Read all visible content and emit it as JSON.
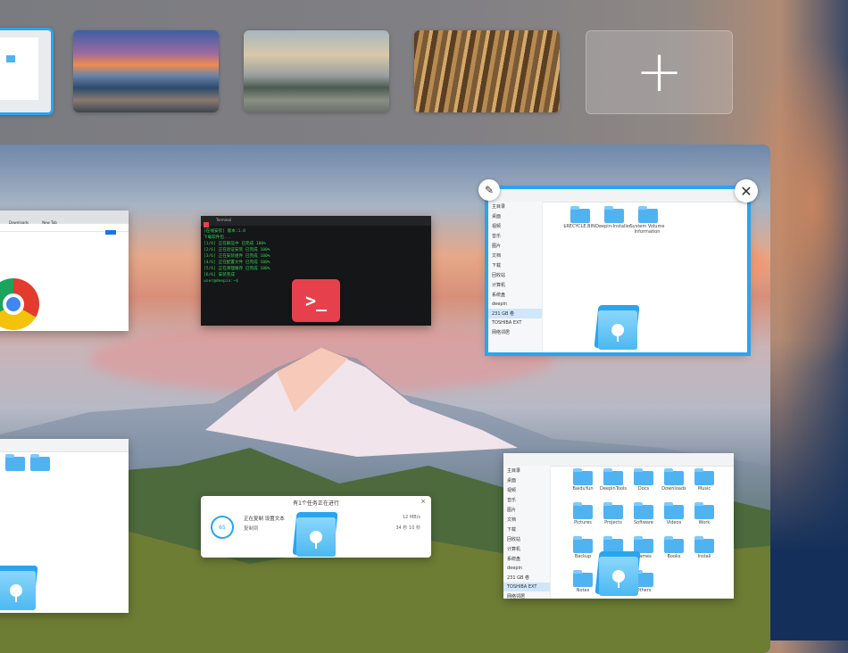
{
  "workspaces": {
    "add_label": "+",
    "items": [
      "workspace-1",
      "workspace-2",
      "workspace-3",
      "workspace-4"
    ]
  },
  "controls": {
    "close_label": "✕",
    "pin_label": "✎"
  },
  "terminal": {
    "tab_label": "Terminal",
    "prompt_glyph": ">_",
    "lines": [
      "[在线安装]  版本:1.0",
      "下载软件包...",
      "[1/6] 正在解压中   已完成 100%",
      "[2/6] 正在验证安装   已完成 100%",
      "[3/6] 正在安装组件   已完成 100%",
      "[4/6] 正在配置文件   已完成 100%",
      "[5/6] 正在清理缓存   已完成 100%",
      "[6/6] 安装完成",
      "user@deepin:~$"
    ]
  },
  "file_manager_top": {
    "sidebar": [
      "主目录",
      "桌面",
      "视频",
      "音乐",
      "图片",
      "文档",
      "下载",
      "回收站",
      "计算机",
      "系统盘",
      "deepin",
      "231 GB 卷",
      "TOSHIBA EXT",
      "网络邻居"
    ],
    "folders": [
      "$RECYCLE.BIN",
      "Deepin-Installer",
      "System Volume Information"
    ]
  },
  "file_manager_bottom": {
    "folders": [
      "BaiduYun",
      "DeepinTools",
      "Docs",
      "Downloads",
      "Music",
      "Pictures",
      "Projects",
      "Software",
      "Videos",
      "Work",
      "Backup",
      "Desktop",
      "Games",
      "Books",
      "Install",
      "Notes",
      "Temp",
      "Others"
    ]
  },
  "copy_dialog": {
    "title": "有1个任务正在进行",
    "percent": "65",
    "line1": "正在复制 设置文本",
    "line2": "复制到",
    "speed": "12 MB/s",
    "remaining": "34 秒 10 秒",
    "close": "×"
  },
  "browser": {
    "tab1": "Downloads",
    "tab2": "New Tab"
  }
}
